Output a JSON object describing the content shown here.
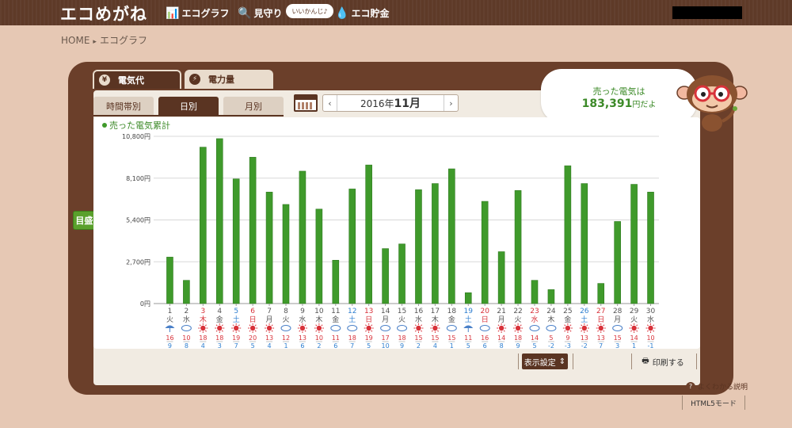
{
  "header": {
    "logo": "エコめがね",
    "nav": [
      {
        "label": "エコグラフ",
        "icon": "bar-chart-icon"
      },
      {
        "label": "見守り",
        "icon": "magnifier-icon"
      },
      {
        "label": "エコ貯金",
        "icon": "piggy-bank-icon"
      }
    ],
    "bubble": "いいかんじ♪"
  },
  "breadcrumb": {
    "home": "HOME",
    "current": "エコグラフ"
  },
  "main_tabs": [
    {
      "label": "電気代",
      "icon": "yen-icon"
    },
    {
      "label": "電力量",
      "icon": "lightning-icon"
    }
  ],
  "sub_tabs": [
    "時間帯別",
    "日別",
    "月別"
  ],
  "date_nav": {
    "prefix": "2016年",
    "month": "11月",
    "prev": "‹",
    "next": "›"
  },
  "summary": {
    "line1": "売った電気は",
    "amount": "183,391",
    "unit": "円だよ"
  },
  "side_button": "目盛",
  "footer": {
    "settings": "表示設定",
    "print": "印刷する",
    "help": "よくわかる説明",
    "html5": "HTML5モード"
  },
  "colors": {
    "bar": "#3f9a2b",
    "weekend": "#2f7fd0",
    "holiday": "#d8323a",
    "weekday": "#555555",
    "accent_green": "#3c8a28"
  },
  "chart_data": {
    "type": "bar",
    "legend": "売った電気累計",
    "ylim": [
      0,
      10800
    ],
    "yticks": [
      0,
      2700,
      5400,
      8100,
      10800
    ],
    "ytick_labels": [
      "0円",
      "2,700円",
      "5,400円",
      "8,100円",
      "10,800円"
    ],
    "categories": [
      "1",
      "2",
      "3",
      "4",
      "5",
      "6",
      "7",
      "8",
      "9",
      "10",
      "11",
      "12",
      "13",
      "14",
      "15",
      "16",
      "17",
      "18",
      "19",
      "20",
      "21",
      "22",
      "23",
      "24",
      "25",
      "26",
      "27",
      "28",
      "29",
      "30"
    ],
    "weekdays": [
      "火",
      "水",
      "木",
      "金",
      "土",
      "日",
      "月",
      "火",
      "水",
      "木",
      "金",
      "土",
      "日",
      "月",
      "火",
      "水",
      "木",
      "金",
      "土",
      "日",
      "月",
      "火",
      "水",
      "木",
      "金",
      "土",
      "日",
      "月",
      "火",
      "水"
    ],
    "day_colors": [
      "weekday",
      "weekday",
      "holiday",
      "weekday",
      "weekend",
      "holiday",
      "weekday",
      "weekday",
      "weekday",
      "weekday",
      "weekday",
      "weekend",
      "holiday",
      "weekday",
      "weekday",
      "weekday",
      "weekday",
      "weekday",
      "weekend",
      "holiday",
      "weekday",
      "weekday",
      "holiday",
      "weekday",
      "weekday",
      "weekend",
      "holiday",
      "weekday",
      "weekday",
      "weekday"
    ],
    "weather": [
      "rain",
      "cloud-rain",
      "sun",
      "sun",
      "sun-cloud",
      "sun",
      "sun",
      "cloud",
      "sun",
      "sun",
      "cloud",
      "cloud",
      "sun",
      "cloud",
      "cloud-sun",
      "sun",
      "sun",
      "cloud",
      "rain",
      "cloud",
      "sun",
      "sun",
      "cloud",
      "cloud",
      "sun",
      "sun",
      "sun",
      "cloud",
      "sun",
      "sun"
    ],
    "temp_high": [
      "16",
      "10",
      "18",
      "18",
      "19",
      "20",
      "13",
      "12",
      "13",
      "10",
      "11",
      "18",
      "19",
      "17",
      "18",
      "15",
      "15",
      "15",
      "11",
      "16",
      "14",
      "18",
      "14",
      "5",
      "9",
      "13",
      "13",
      "15",
      "14",
      "10"
    ],
    "temp_low": [
      "9",
      "8",
      "4",
      "3",
      "7",
      "5",
      "4",
      "1",
      "6",
      "2",
      "6",
      "7",
      "5",
      "10",
      "9",
      "2",
      "4",
      "1",
      "5",
      "6",
      "8",
      "9",
      "5",
      "-2",
      "-3",
      "-2",
      "7",
      "3",
      "1",
      "-1"
    ],
    "series": [
      {
        "values": [
          3000,
          1500,
          10100,
          10650,
          8050,
          9450,
          7200,
          6400,
          8550,
          6100,
          2800,
          7400,
          8950,
          3550,
          3850,
          7350,
          7750,
          8700,
          700,
          6600,
          3350,
          7300,
          1500,
          900,
          8900,
          7750,
          1300,
          5300,
          7700,
          7200
        ]
      }
    ]
  }
}
